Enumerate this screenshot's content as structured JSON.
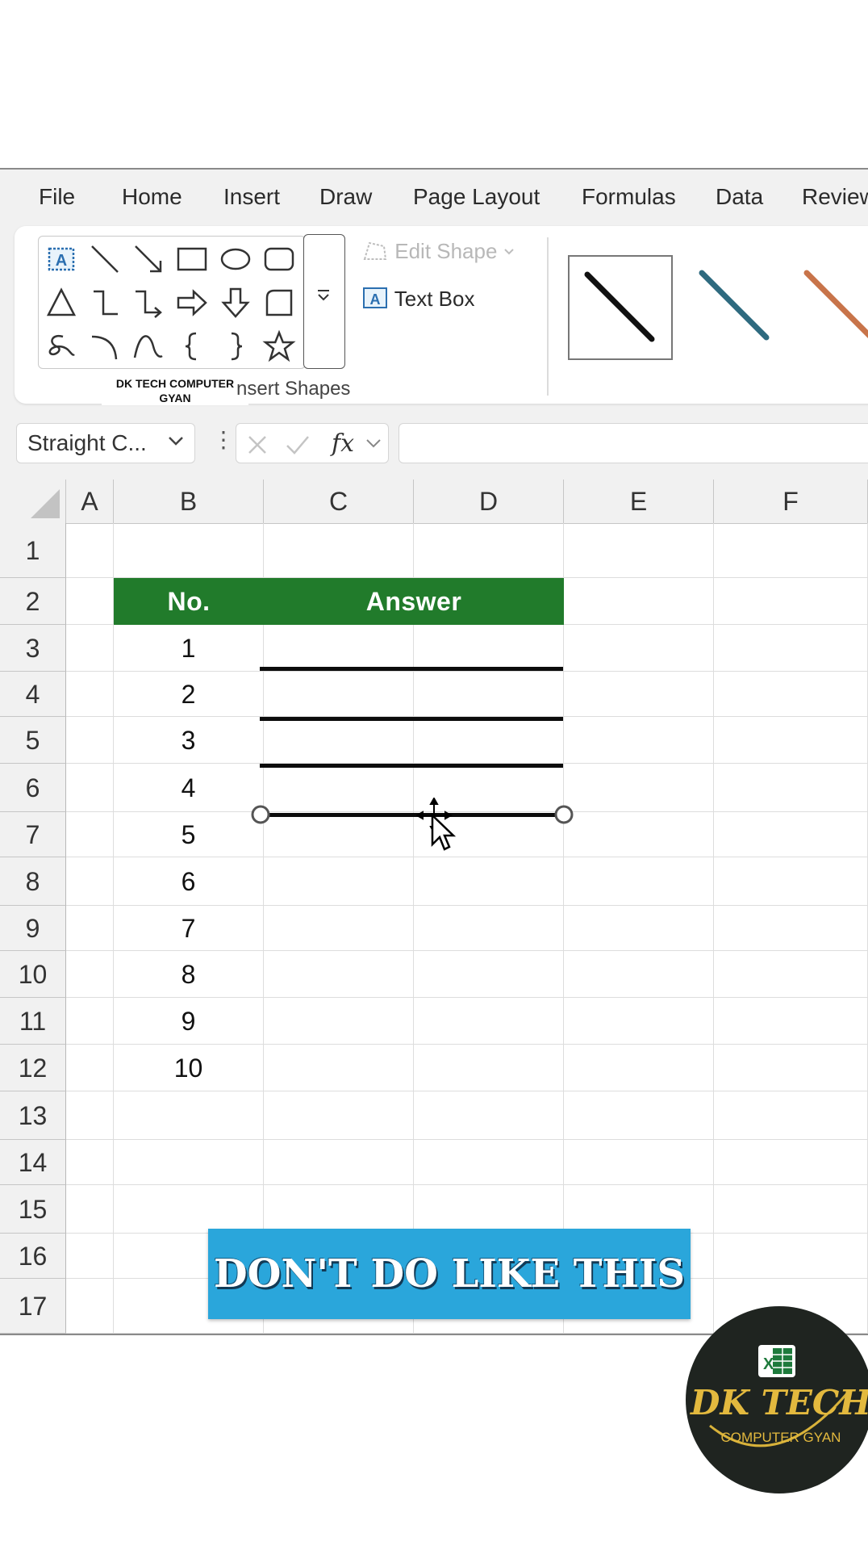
{
  "ribbon_tabs": [
    "File",
    "Home",
    "Insert",
    "Draw",
    "Page Layout",
    "Formulas",
    "Data",
    "Review"
  ],
  "ribbon": {
    "edit_shape_label": "Edit Shape",
    "text_box_label": "Text Box",
    "insert_shapes_label": "nsert Shapes",
    "watermark_line1": "DK TECH COMPUTER",
    "watermark_line2": "GYAN",
    "shape_icons": [
      "text-box",
      "line",
      "arrow-line",
      "rectangle",
      "oval",
      "rounded-rectangle",
      "triangle",
      "elbow-connector",
      "elbow-arrow-connector",
      "right-arrow",
      "down-arrow",
      "snip-rectangle",
      "freeform-scribble",
      "arc",
      "curve",
      "left-brace",
      "right-brace",
      "star"
    ],
    "style_colors": [
      "#111111",
      "#2e6a7f",
      "#c8744a"
    ]
  },
  "formula_bar": {
    "name_box_value": "Straight C...",
    "fx_label": "fx",
    "formula_value": ""
  },
  "sheet": {
    "columns": [
      "A",
      "B",
      "C",
      "D",
      "E",
      "F"
    ],
    "rows": [
      "1",
      "2",
      "3",
      "4",
      "5",
      "6",
      "7",
      "8",
      "9",
      "10",
      "11",
      "12",
      "13",
      "14",
      "15",
      "16",
      "17"
    ],
    "header_no": "No.",
    "header_answer": "Answer",
    "header_color": "#217b2b",
    "numbers": [
      "1",
      "2",
      "3",
      "4",
      "5",
      "6",
      "7",
      "8",
      "9",
      "10"
    ]
  },
  "banner": {
    "text": "DON'T DO LIKE THIS",
    "color": "#2aa6db"
  },
  "logo": {
    "title": "DK TECH",
    "subtitle": "COMPUTER GYAN",
    "badge": "X"
  }
}
